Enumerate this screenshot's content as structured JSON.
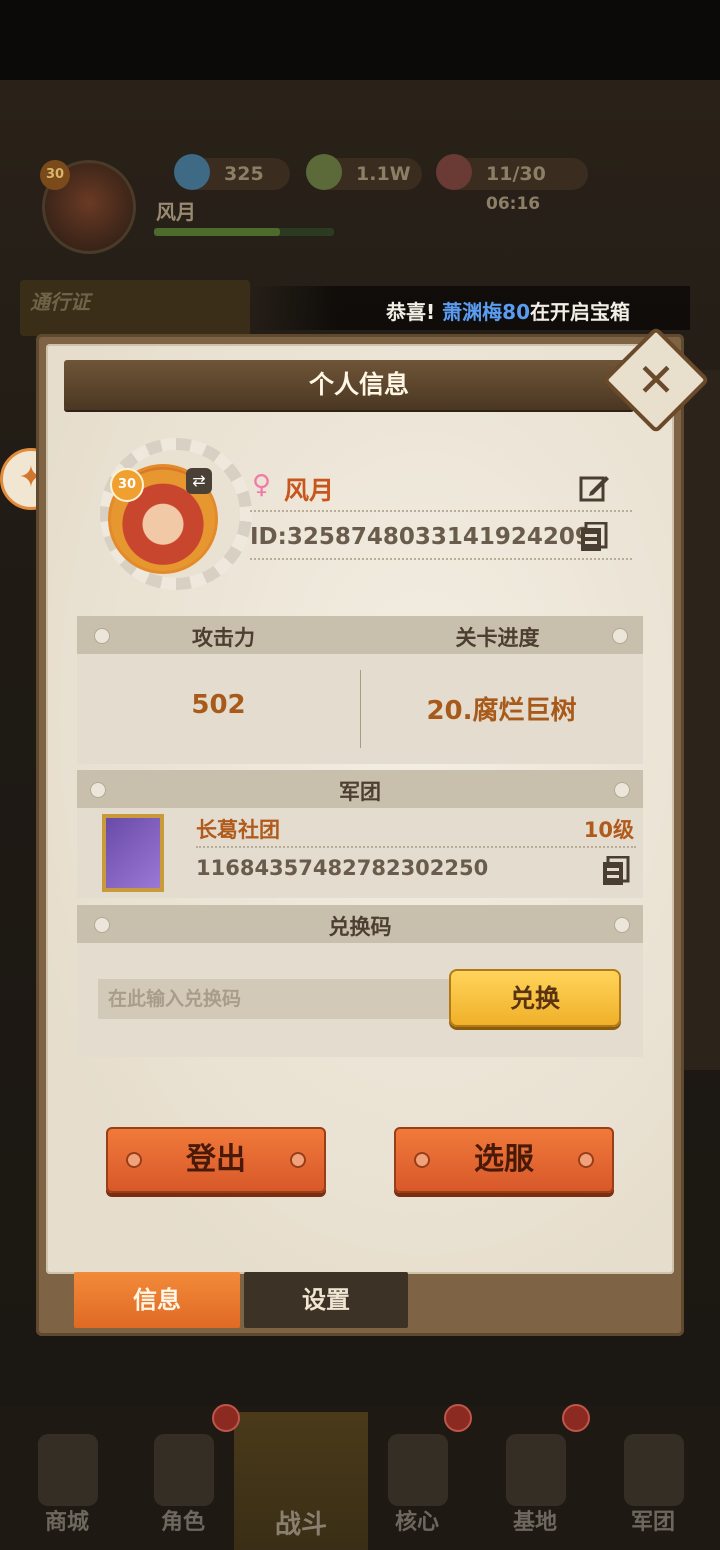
{
  "hud": {
    "level": "30",
    "player_name": "风月",
    "gems": "325",
    "coins": "1.1W",
    "stamina": "11/30",
    "stamina_timer": "06:16"
  },
  "pass_label": "通行证",
  "ticker": {
    "prefix": "恭喜!",
    "highlight": "萧渊梅80",
    "suffix": "在开启宝箱"
  },
  "modal": {
    "title": "个人信息",
    "profile": {
      "level": "30",
      "name": "风月",
      "id": "ID:3258748033141924209"
    },
    "stats": {
      "power_label": "攻击力",
      "power_value": "502",
      "stage_label": "关卡进度",
      "stage_value": "20.腐烂巨树"
    },
    "guild": {
      "header": "军团",
      "name": "长葛社团",
      "level": "10级",
      "id": "11684357482782302250"
    },
    "redeem": {
      "header": "兑换码",
      "placeholder": "在此输入兑换码",
      "button": "兑换"
    },
    "logout_button": "登出",
    "server_button": "选服",
    "tabs": [
      "信息",
      "设置"
    ]
  },
  "nav": [
    "商城",
    "角色",
    "战斗",
    "核心",
    "基地",
    "军团"
  ],
  "colors": {
    "accent_orange": "#e0662a",
    "gold_button": "#f0b02a",
    "name_orange": "#c8561c",
    "ticker_blue": "#5a9cf0"
  }
}
